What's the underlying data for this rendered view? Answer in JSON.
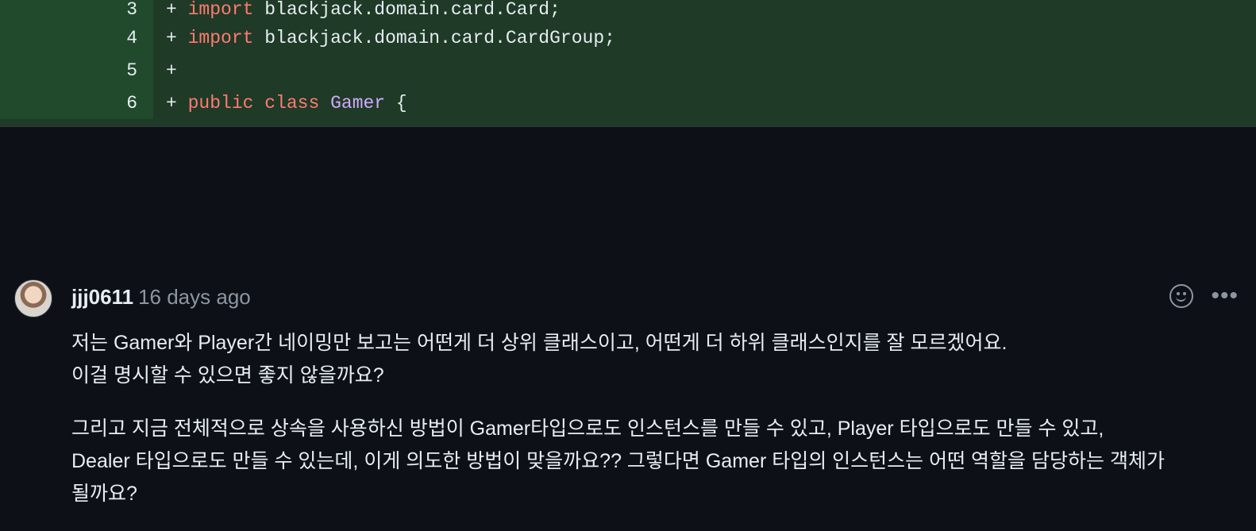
{
  "diff": {
    "lines": [
      {
        "num": "3",
        "plus": "+",
        "kw": "import",
        "rest": " blackjack.domain.card.Card;"
      },
      {
        "num": "4",
        "plus": "+",
        "kw": "import",
        "rest": " blackjack.domain.card.CardGroup;"
      },
      {
        "num": "5",
        "plus": "+"
      },
      {
        "num": "6",
        "plus": "+",
        "kw1": "public",
        "kw2": "class",
        "cls": "Gamer",
        "tail": " {"
      }
    ]
  },
  "comment": {
    "author": "jjj0611",
    "time": "16 days ago",
    "paragraphs": [
      [
        "저는 Gamer와 Player간 네이밍만 보고는 어떤게 더 상위 클래스이고, 어떤게 더 하위 클래스인지를 잘 모르겠어요.",
        "이걸 명시할 수 있으면 좋지 않을까요?"
      ],
      [
        "그리고 지금 전체적으로 상속을 사용하신 방법이 Gamer타입으로도 인스턴스를 만들 수 있고, Player 타입으로도 만들 수 있고,",
        "Dealer 타입으로도 만들 수 있는데, 이게 의도한 방법이 맞을까요?? 그렇다면 Gamer 타입의 인스턴스는 어떤 역할을 담당하는 객체가",
        "될까요?"
      ]
    ]
  }
}
